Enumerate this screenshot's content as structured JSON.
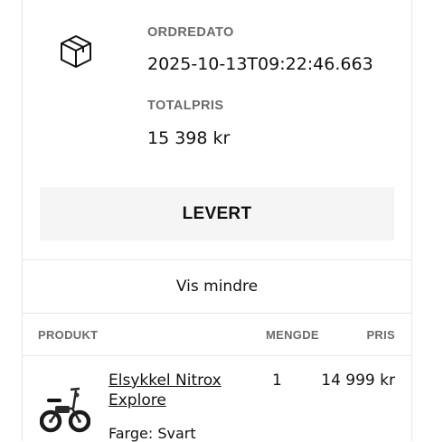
{
  "order": {
    "date_label": "ORDREDATO",
    "date_value": "2025-10-13T09:22:46.663",
    "total_label": "TOTALPRIS",
    "total_value": "15 398 kr",
    "status": "LEVERT",
    "toggle_label": "Vis mindre",
    "icon": "box-icon"
  },
  "table": {
    "headers": {
      "product": "PRODUKT",
      "quantity": "MENGDE",
      "price": "PRIS"
    },
    "rows": [
      {
        "image": "e-bike-icon",
        "name": "Elsykkel Nitrox Explore",
        "variant": "Farge: Svart",
        "quantity": "1",
        "price": "14 999 kr"
      }
    ]
  }
}
